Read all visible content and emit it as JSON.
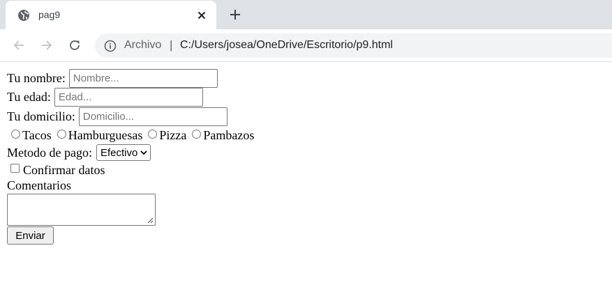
{
  "browser": {
    "tab": {
      "title": "pag9",
      "favicon": "globe-icon",
      "close_icon": "close-icon"
    },
    "new_tab_icon": "plus-icon",
    "toolbar": {
      "back_icon": "back-arrow-icon",
      "forward_icon": "forward-arrow-icon",
      "reload_icon": "reload-icon",
      "info_icon": "info-icon",
      "scheme_label": "Archivo",
      "separator": "|",
      "url": "C:/Users/josea/OneDrive/Escritorio/p9.html"
    },
    "colors": {
      "tabstrip": "#dee1e6",
      "omnibox": "#f1f3f4"
    }
  },
  "form": {
    "name": {
      "label": "Tu nombre:",
      "placeholder": "Nombre...",
      "value": ""
    },
    "age": {
      "label": "Tu edad:",
      "placeholder": "Edad...",
      "value": ""
    },
    "address": {
      "label": "Tu domicilio:",
      "placeholder": "Domicilio...",
      "value": ""
    },
    "food_options": [
      {
        "label": "Tacos",
        "checked": false
      },
      {
        "label": "Hamburguesas",
        "checked": false
      },
      {
        "label": "Pizza",
        "checked": false
      },
      {
        "label": "Pambazos",
        "checked": false
      }
    ],
    "payment": {
      "label": "Metodo de pago:",
      "selected": "Efectivo"
    },
    "confirm": {
      "label": "Confirmar datos",
      "checked": false
    },
    "comments": {
      "label": "Comentarios",
      "value": ""
    },
    "submit_label": "Enviar"
  }
}
